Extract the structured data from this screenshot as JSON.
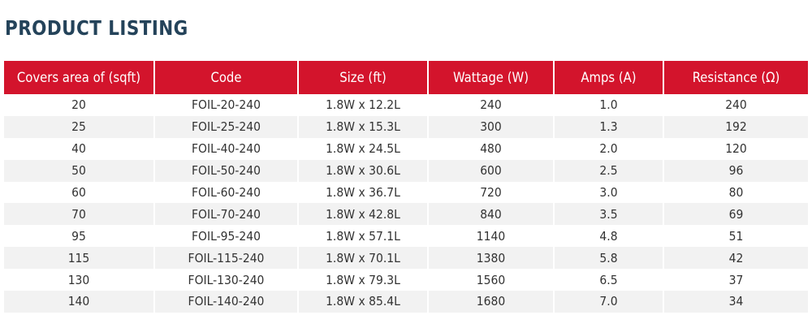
{
  "page_title": "PRODUCT LISTING",
  "table": {
    "headers": [
      "Covers area of (sqft)",
      "Code",
      "Size (ft)",
      "Wattage (W)",
      "Amps (A)",
      "Resistance (Ω)"
    ],
    "rows": [
      [
        "20",
        "FOIL-20-240",
        "1.8W x 12.2L",
        "240",
        "1.0",
        "240"
      ],
      [
        "25",
        "FOIL-25-240",
        "1.8W x 15.3L",
        "300",
        "1.3",
        "192"
      ],
      [
        "40",
        "FOIL-40-240",
        "1.8W x 24.5L",
        "480",
        "2.0",
        "120"
      ],
      [
        "50",
        "FOIL-50-240",
        "1.8W x 30.6L",
        "600",
        "2.5",
        "96"
      ],
      [
        "60",
        "FOIL-60-240",
        "1.8W x 36.7L",
        "720",
        "3.0",
        "80"
      ],
      [
        "70",
        "FOIL-70-240",
        "1.8W x 42.8L",
        "840",
        "3.5",
        "69"
      ],
      [
        "95",
        "FOIL-95-240",
        "1.8W x 57.1L",
        "1140",
        "4.8",
        "51"
      ],
      [
        "115",
        "FOIL-115-240",
        "1.8W x 70.1L",
        "1380",
        "5.8",
        "42"
      ],
      [
        "130",
        "FOIL-130-240",
        "1.8W x 79.3L",
        "1560",
        "6.5",
        "37"
      ],
      [
        "140",
        "FOIL-140-240",
        "1.8W x 85.4L",
        "1680",
        "7.0",
        "34"
      ]
    ]
  },
  "colors": {
    "title": "#24435a",
    "header_background": "#d3142c",
    "header_text": "#ffffff",
    "row_alt_background": "#f2f2f2",
    "cell_text": "#333333"
  }
}
